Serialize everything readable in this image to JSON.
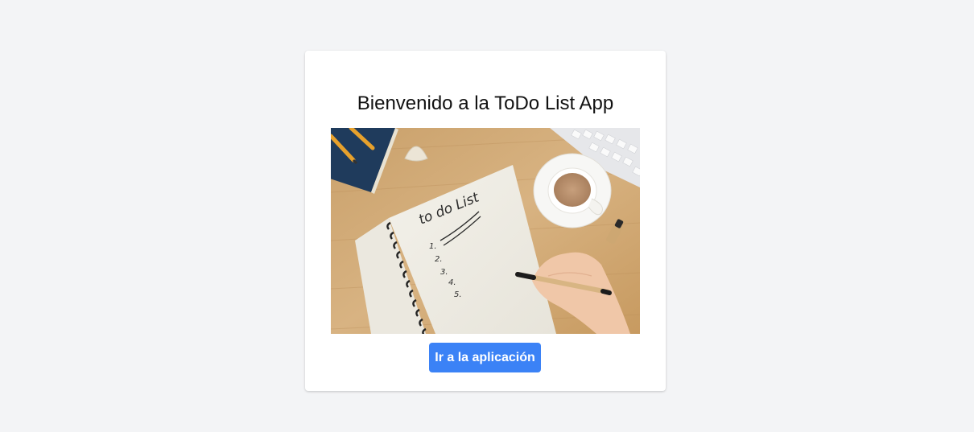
{
  "welcome": {
    "title": "Bienvenido a la ToDo List App",
    "image_handwritten_heading": "to do List",
    "image_list_numbers": [
      "1.",
      "2.",
      "3.",
      "4.",
      "5."
    ],
    "button_label": "Ir a la aplicación"
  },
  "colors": {
    "page_background": "#f3f4f6",
    "card_background": "#ffffff",
    "button_background": "#3b82f6",
    "button_text": "#ffffff",
    "title_text": "#111111"
  }
}
